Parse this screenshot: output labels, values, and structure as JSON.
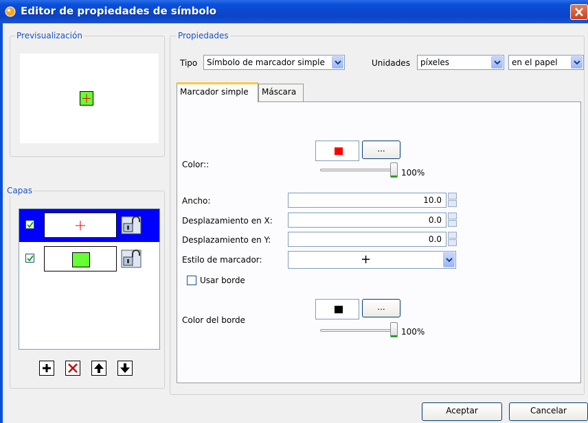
{
  "window": {
    "title": "Editor de propiedades de símbolo"
  },
  "preview": {
    "group_label": "Previsualización"
  },
  "layers": {
    "group_label": "Capas",
    "items": [
      {
        "visible": true,
        "selected": true,
        "kind": "cross"
      },
      {
        "visible": true,
        "selected": false,
        "kind": "square"
      }
    ]
  },
  "toolbar": {
    "add_icon": "plus-icon",
    "remove_icon": "x-icon",
    "up_icon": "arrow-up-icon",
    "down_icon": "arrow-down-icon"
  },
  "properties": {
    "group_label": "Propiedades",
    "tipo_label": "Tipo",
    "tipo_value": "Símbolo de marcador simple",
    "unidades_label": "Unidades",
    "unidades_value": "píxeles",
    "papel_value": "en el papel"
  },
  "tabs": [
    {
      "label": "Marcador simple",
      "active": true
    },
    {
      "label": "Máscara",
      "active": false
    }
  ],
  "marker": {
    "color_label": "Color::",
    "color_hex": "#ff0000",
    "color_button": "...",
    "color_alpha": "100%",
    "ancho_label": "Ancho:",
    "ancho_value": "10.0",
    "despx_label": "Desplazamiento en X:",
    "despx_value": "0.0",
    "despy_label": "Desplazamiento en Y:",
    "despy_value": "0.0",
    "estilo_label": "Estilo de marcador:",
    "estilo_value": "+",
    "usar_borde_label": "Usar borde",
    "usar_borde_checked": false,
    "borde_label": "Color del borde",
    "borde_hex": "#000000",
    "borde_button": "...",
    "borde_alpha": "100%"
  },
  "buttons": {
    "ok": "Aceptar",
    "cancel": "Cancelar"
  },
  "colors": {
    "titlebar": "#0a4fd8",
    "group_label": "#1a52c0",
    "selected_row": "#0000ff",
    "marker_fill": "#66ff33"
  }
}
